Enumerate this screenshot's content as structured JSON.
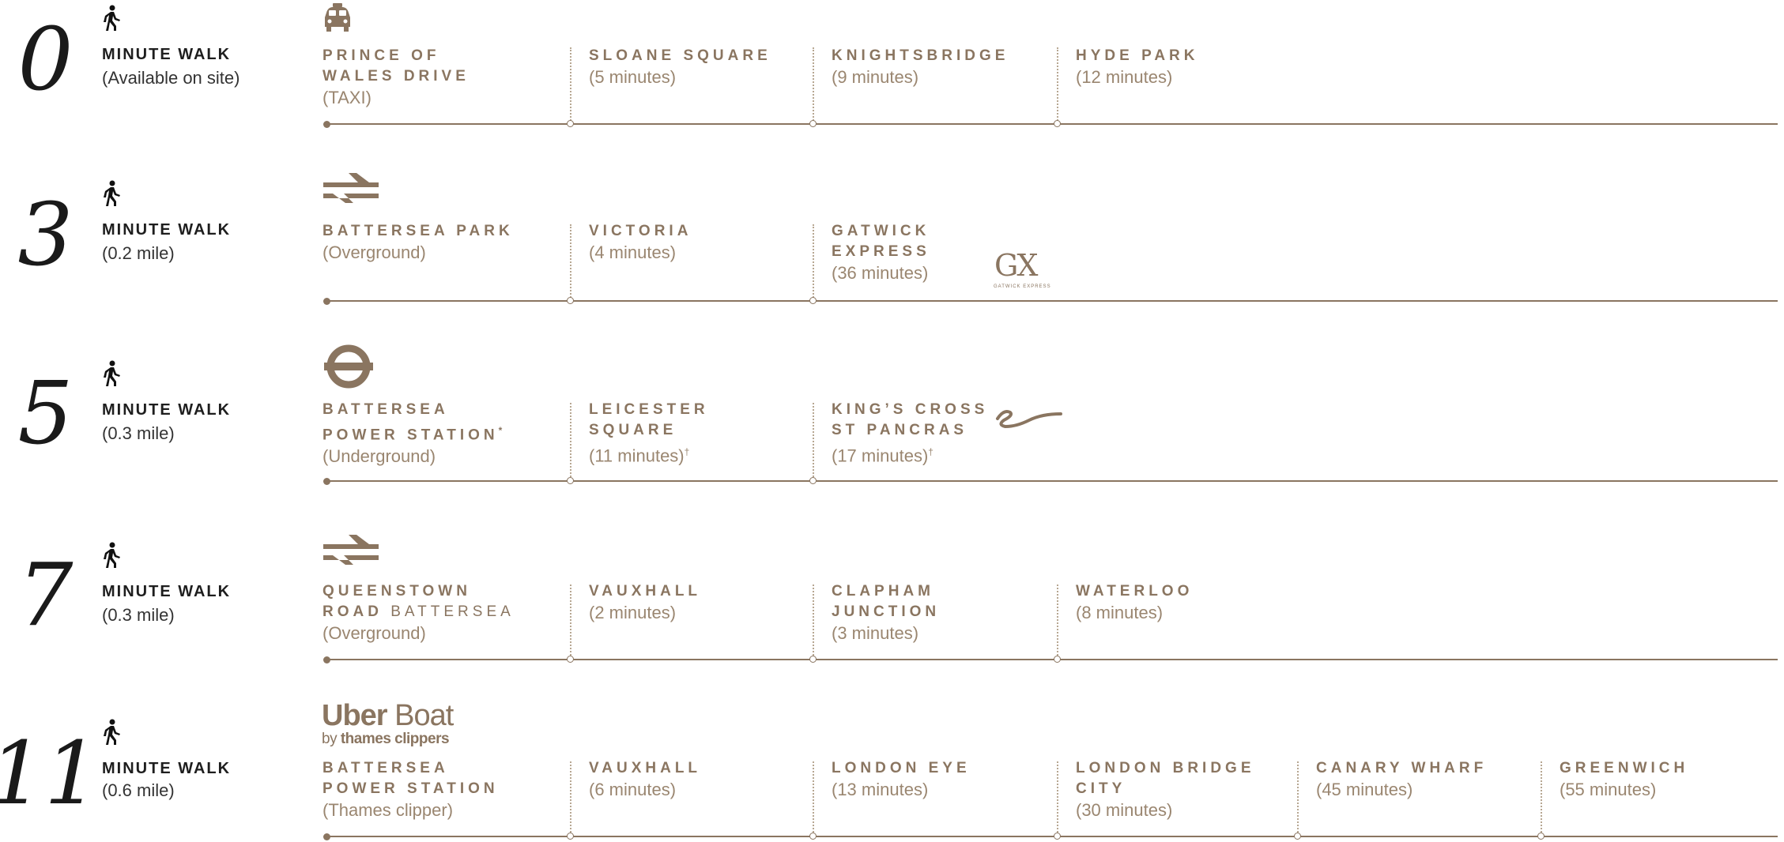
{
  "rows": [
    {
      "number": "0",
      "walk_label": "MINUTE WALK",
      "walk_sub": "(Available on site)",
      "mode_icon": "taxi-icon",
      "stops": [
        {
          "name": "PRINCE OF",
          "name2": "WALES DRIVE",
          "sub": "(TAXI)"
        },
        {
          "name": "SLOANE SQUARE",
          "sub": "(5 minutes)"
        },
        {
          "name": "KNIGHTSBRIDGE",
          "sub": "(9 minutes)"
        },
        {
          "name": "HYDE PARK",
          "sub": "(12 minutes)"
        }
      ]
    },
    {
      "number": "3",
      "walk_label": "MINUTE WALK",
      "walk_sub": "(0.2 mile)",
      "mode_icon": "national-rail-icon",
      "stops": [
        {
          "name": "BATTERSEA PARK",
          "sub": "(Overground)"
        },
        {
          "name": "VICTORIA",
          "sub": "(4 minutes)"
        },
        {
          "name": "GATWICK",
          "name2": "EXPRESS",
          "sub": "(36 minutes)"
        }
      ],
      "logo_text": "GX",
      "logo_sub": "GATWICK EXPRESS"
    },
    {
      "number": "5",
      "walk_label": "MINUTE WALK",
      "walk_sub": "(0.3 mile)",
      "mode_icon": "underground-roundel-icon",
      "stops": [
        {
          "name": "BATTERSEA",
          "name2": "POWER STATION",
          "name2_mark": "*",
          "sub": "(Underground)"
        },
        {
          "name": "LEICESTER",
          "name2": "SQUARE",
          "sub": "(11 minutes)",
          "sub_mark": "†"
        },
        {
          "name": "KING’S CROSS",
          "name2": "ST PANCRAS",
          "sub": "(17 minutes)",
          "sub_mark": "†"
        }
      ],
      "logo_icon": "eurostar-icon"
    },
    {
      "number": "7",
      "walk_label": "MINUTE WALK",
      "walk_sub": "(0.3 mile)",
      "mode_icon": "national-rail-icon",
      "stops": [
        {
          "name": "QUEENSTOWN",
          "name2": "ROAD",
          "name2_light": "BATTERSEA",
          "sub": "(Overground)"
        },
        {
          "name": "VAUXHALL",
          "sub": "(2 minutes)"
        },
        {
          "name": "CLAPHAM",
          "name2": "JUNCTION",
          "sub": "(3 minutes)"
        },
        {
          "name": "WATERLOO",
          "sub": "(8 minutes)"
        }
      ]
    },
    {
      "number": "11",
      "walk_label": "MINUTE WALK",
      "walk_sub": "(0.6 mile)",
      "mode_logo": {
        "bold": "Uber",
        "light": "Boat",
        "by": "by",
        "brand": "thames clippers"
      },
      "stops": [
        {
          "name": "BATTERSEA",
          "name2": "POWER STATION",
          "sub": "(Thames clipper)"
        },
        {
          "name": "VAUXHALL",
          "sub": "(6 minutes)"
        },
        {
          "name": "LONDON EYE",
          "sub": "(13 minutes)"
        },
        {
          "name": "LONDON BRIDGE",
          "name2": "CITY",
          "sub": "(30 minutes)"
        },
        {
          "name": "CANARY WHARF",
          "sub": "(45 minutes)"
        },
        {
          "name": "GREENWICH",
          "sub": "(55 minutes)"
        }
      ]
    }
  ],
  "colors": {
    "accent": "#8a7560",
    "number": "#1a1a1a"
  }
}
